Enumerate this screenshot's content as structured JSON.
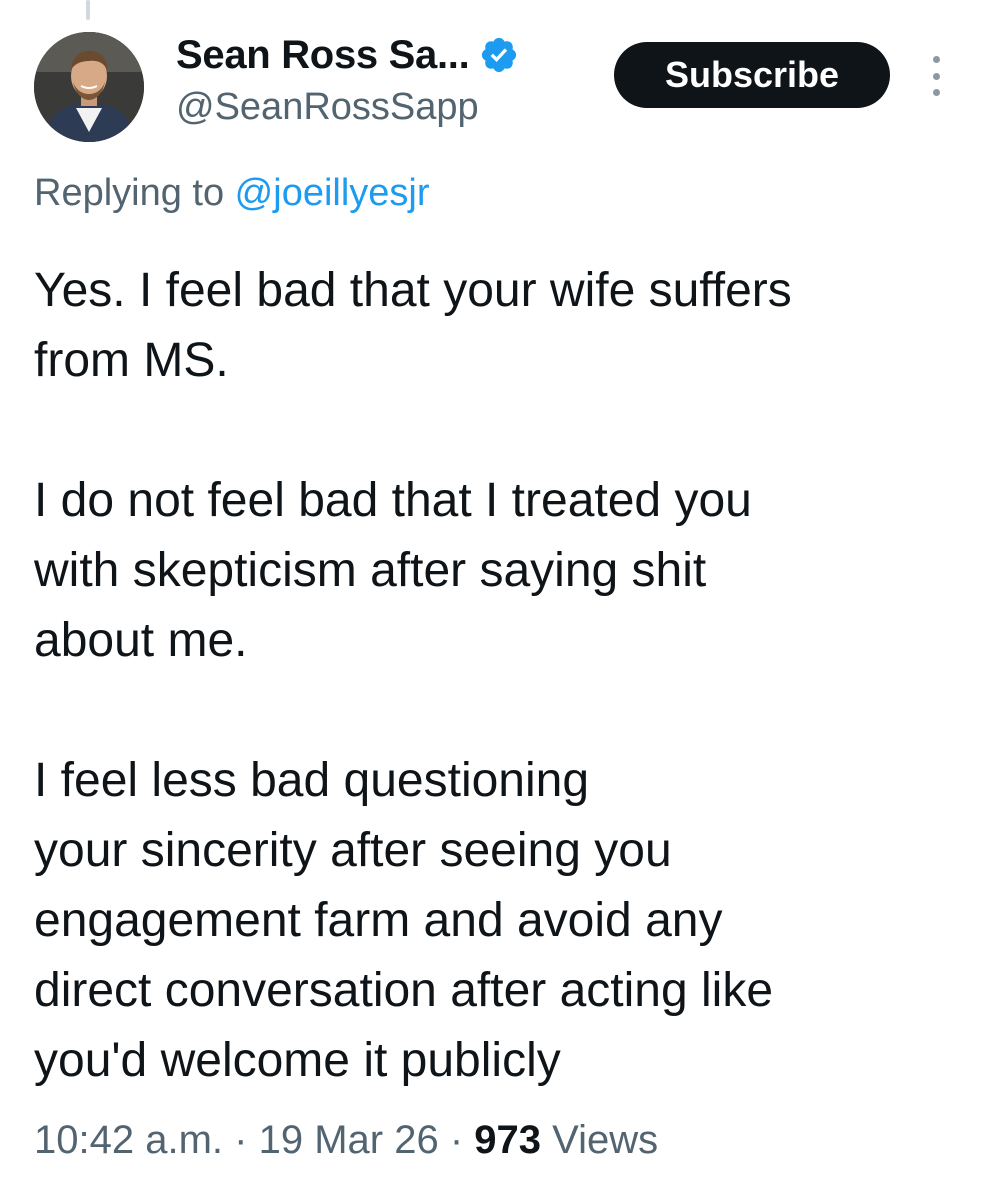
{
  "author": {
    "display_name": "Sean Ross Sa...",
    "handle": "@SeanRossSapp",
    "verified": true,
    "verified_color": "#1d9bf0"
  },
  "actions": {
    "subscribe_label": "Subscribe",
    "more_icon": "more-vertical-icon"
  },
  "reply": {
    "prefix": "Replying to ",
    "to_handle": "@joeillyesjr"
  },
  "tweet": {
    "paragraphs": [
      [
        "Yes. I feel bad that your wife suffers",
        "from MS."
      ],
      [
        "I do not feel bad that I treated you",
        "with skepticism after saying shit",
        "about me."
      ],
      [
        "I feel less bad questioning",
        "your sincerity after seeing you",
        "engagement farm and avoid any",
        "direct conversation after acting like",
        "you'd welcome it publicly"
      ]
    ]
  },
  "meta": {
    "time": "10:42 a.m.",
    "date": "19 Mar 26",
    "views_count": "973",
    "views_label": "Views",
    "separator": "·"
  },
  "colors": {
    "accent": "#1d9bf0",
    "text_primary": "#0f1419",
    "text_secondary": "#536471"
  }
}
